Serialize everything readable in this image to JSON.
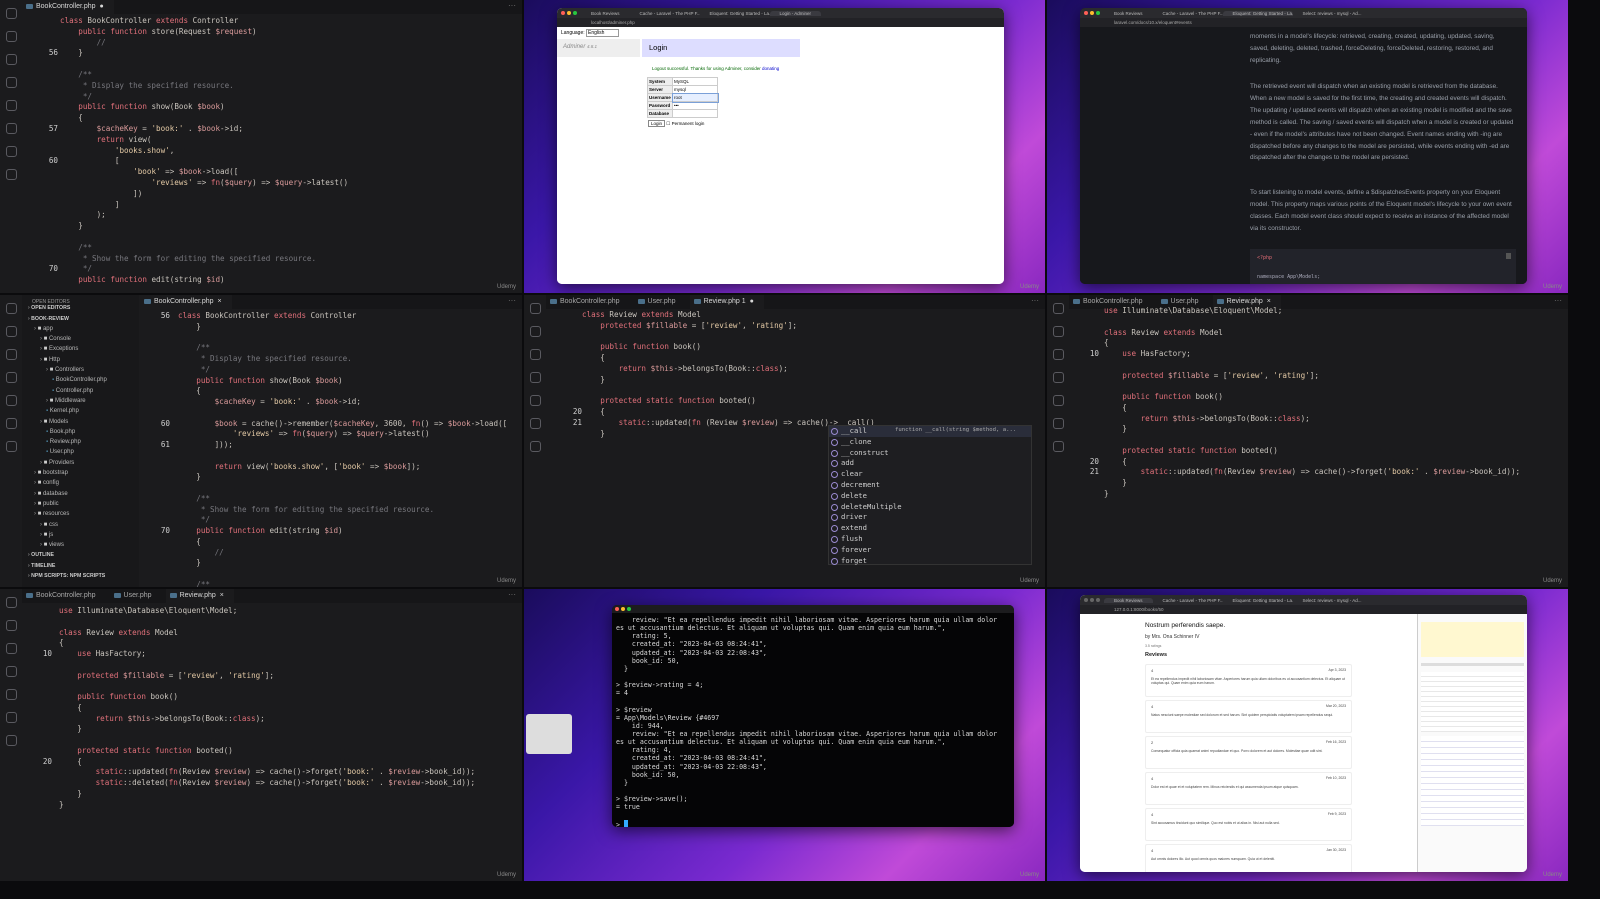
{
  "watermark": "Udemy",
  "p1": {
    "tabs": [
      {
        "label": "BookController.php",
        "state": "●"
      }
    ],
    "lines": [
      [
        "",
        "class BookController extends Controller"
      ],
      [
        "",
        "    public function store(Request $request)"
      ],
      [
        "",
        "        //"
      ],
      [
        "56",
        "    }"
      ],
      [
        "",
        ""
      ],
      [
        "",
        "    /**"
      ],
      [
        "",
        "     * Display the specified resource."
      ],
      [
        "",
        "     */"
      ],
      [
        "",
        "    public function show(Book $book)"
      ],
      [
        "",
        "    {"
      ],
      [
        "57",
        "        $cacheKey = 'book:' . $book->id;"
      ],
      [
        "",
        "        return view("
      ],
      [
        "",
        "            'books.show',"
      ],
      [
        "60",
        "            ["
      ],
      [
        "",
        "                'book' => $book->load(["
      ],
      [
        "",
        "                    'reviews' => fn($query) => $query->latest()"
      ],
      [
        "",
        "                ])"
      ],
      [
        "",
        "            ]"
      ],
      [
        "",
        "        );"
      ],
      [
        "",
        "    }"
      ],
      [
        "",
        ""
      ],
      [
        "",
        "    /**"
      ],
      [
        "",
        "     * Show the form for editing the specified resource."
      ],
      [
        "70",
        "     */"
      ],
      [
        "",
        "    public function edit(string $id)"
      ]
    ]
  },
  "p2": {
    "tabs": [
      "Book Reviews",
      "Cache - Laravel - The PHP F...",
      "Eloquent: Getting Started - La...",
      "Login - Adminer"
    ],
    "url": "localhost/adminer.php",
    "language_label": "Language:",
    "language_value": "English",
    "app_name": "Adminer",
    "app_version": "4.8.1",
    "title": "Login",
    "message": "Logout successful. Thanks for using Adminer, consider",
    "message_link": "donating",
    "fields": [
      {
        "label": "System",
        "value": "MySQL"
      },
      {
        "label": "Server",
        "value": "mysql"
      },
      {
        "label": "Username",
        "value": "root"
      },
      {
        "label": "Password",
        "value": "•••"
      },
      {
        "label": "Database",
        "value": ""
      }
    ],
    "login_button": "Login",
    "permanent_label": "Permanent login"
  },
  "p3": {
    "tabs": [
      "Book Reviews",
      "Cache - Laravel - The PHP F...",
      "Eloquent: Getting Started - La...",
      "Select: reviews - mysql - Ad..."
    ],
    "url": "laravel.com/docs/10.x/eloquent#events",
    "paragraphs": [
      "moments in a model's lifecycle: retrieved, creating, created, updating, updated, saving, saved, deleting, deleted, trashed, forceDeleting, forceDeleted, restoring, restored, and replicating.",
      "The retrieved event will dispatch when an existing model is retrieved from the database. When a new model is saved for the first time, the creating and created events will dispatch. The updating / updated events will dispatch when an existing model is modified and the save method is called. The saving / saved events will dispatch when a model is created or updated - even if the model's attributes have not been changed. Event names ending with -ing are dispatched before any changes to the model are persisted, while events ending with -ed are dispatched after the changes to the model are persisted.",
      "To start listening to model events, define a $dispatchesEvents property on your Eloquent model. This property maps various points of the Eloquent model's lifecycle to your own event classes. Each model event class should expect to receive an instance of the affected model via its constructor."
    ],
    "code": [
      "<?php",
      "namespace App\\Models;"
    ]
  },
  "p4": {
    "explorer_title": "OPEN EDITORS",
    "tabs": [
      {
        "label": "BookController.php",
        "state": "×"
      }
    ],
    "tree": [
      {
        "d": 0,
        "t": "OPEN EDITORS",
        "h": 1
      },
      {
        "d": 0,
        "t": "BOOK-REVIEW",
        "h": 1
      },
      {
        "d": 1,
        "t": "app",
        "f": 1
      },
      {
        "d": 2,
        "t": "Console",
        "f": 1
      },
      {
        "d": 2,
        "t": "Exceptions",
        "f": 1
      },
      {
        "d": 2,
        "t": "Http",
        "f": 1
      },
      {
        "d": 3,
        "t": "Controllers",
        "f": 1
      },
      {
        "d": 4,
        "t": "BookController.php"
      },
      {
        "d": 4,
        "t": "Controller.php"
      },
      {
        "d": 3,
        "t": "Middleware",
        "f": 1
      },
      {
        "d": 3,
        "t": "Kernel.php"
      },
      {
        "d": 2,
        "t": "Models",
        "f": 1
      },
      {
        "d": 3,
        "t": "Book.php"
      },
      {
        "d": 3,
        "t": "Review.php"
      },
      {
        "d": 3,
        "t": "User.php"
      },
      {
        "d": 2,
        "t": "Providers",
        "f": 1
      },
      {
        "d": 1,
        "t": "bootstrap",
        "f": 1
      },
      {
        "d": 1,
        "t": "config",
        "f": 1
      },
      {
        "d": 1,
        "t": "database",
        "f": 1
      },
      {
        "d": 1,
        "t": "public",
        "f": 1
      },
      {
        "d": 1,
        "t": "resources",
        "f": 1
      },
      {
        "d": 2,
        "t": "css",
        "f": 1
      },
      {
        "d": 2,
        "t": "js",
        "f": 1
      },
      {
        "d": 2,
        "t": "views",
        "f": 1
      },
      {
        "d": 0,
        "t": "OUTLINE",
        "h": 1
      },
      {
        "d": 0,
        "t": "TIMELINE",
        "h": 1
      },
      {
        "d": 0,
        "t": "NPM SCRIPTS: NPM SCRIPTS",
        "h": 1
      }
    ],
    "lines": [
      [
        "56",
        "class BookController extends Controller"
      ],
      [
        "",
        "    }"
      ],
      [
        "",
        ""
      ],
      [
        "",
        "    /**"
      ],
      [
        "",
        "     * Display the specified resource."
      ],
      [
        "",
        "     */"
      ],
      [
        "",
        "    public function show(Book $book)"
      ],
      [
        "",
        "    {"
      ],
      [
        "",
        "        $cacheKey = 'book:' . $book->id;"
      ],
      [
        "",
        ""
      ],
      [
        "60",
        "        $book = cache()->remember($cacheKey, 3600, fn() => $book->load(["
      ],
      [
        "",
        "            'reviews' => fn($query) => $query->latest()"
      ],
      [
        "61",
        "        ]));"
      ],
      [
        "",
        ""
      ],
      [
        "",
        "        return view('books.show', ['book' => $book]);"
      ],
      [
        "",
        "    }"
      ],
      [
        "",
        ""
      ],
      [
        "",
        "    /**"
      ],
      [
        "",
        "     * Show the form for editing the specified resource."
      ],
      [
        "",
        "     */"
      ],
      [
        "70",
        "    public function edit(string $id)"
      ],
      [
        "",
        "    {"
      ],
      [
        "",
        "        //"
      ],
      [
        "",
        "    }"
      ],
      [
        "",
        ""
      ],
      [
        "",
        "    /**"
      ]
    ]
  },
  "p5": {
    "tabs": [
      {
        "label": "BookController.php",
        "state": ""
      },
      {
        "label": "User.php",
        "state": ""
      },
      {
        "label": "Review.php 1",
        "state": "●"
      }
    ],
    "lines": [
      [
        "",
        "class Review extends Model"
      ],
      [
        "",
        "    protected $fillable = ['review', 'rating'];"
      ],
      [
        "",
        ""
      ],
      [
        "",
        "    public function book()"
      ],
      [
        "",
        "    {"
      ],
      [
        "",
        "        return $this->belongsTo(Book::class);"
      ],
      [
        "",
        "    }"
      ],
      [
        "",
        ""
      ],
      [
        "",
        "    protected static function booted()"
      ],
      [
        "20",
        "    {"
      ],
      [
        "21",
        "        static::updated(fn (Review $review) => cache()->__call()"
      ],
      [
        "",
        "    }"
      ]
    ],
    "autocomplete": [
      "__call",
      "__clone",
      "__construct",
      "add",
      "clear",
      "decrement",
      "delete",
      "deleteMultiple",
      "driver",
      "extend",
      "flush",
      "forever",
      "forget"
    ],
    "autocomplete_detail": "function __call(string $method, a..."
  },
  "p6": {
    "tabs": [
      {
        "label": "BookController.php",
        "state": ""
      },
      {
        "label": "User.php",
        "state": ""
      },
      {
        "label": "Review.php",
        "state": "×"
      }
    ],
    "lines": [
      [
        "",
        "use Illuminate\\Database\\Eloquent\\Model;"
      ],
      [
        "",
        ""
      ],
      [
        "",
        "class Review extends Model"
      ],
      [
        "",
        "{"
      ],
      [
        "10",
        "    use HasFactory;"
      ],
      [
        "",
        ""
      ],
      [
        "",
        "    protected $fillable = ['review', 'rating'];"
      ],
      [
        "",
        ""
      ],
      [
        "",
        "    public function book()"
      ],
      [
        "",
        "    {"
      ],
      [
        "",
        "        return $this->belongsTo(Book::class);"
      ],
      [
        "",
        "    }"
      ],
      [
        "",
        ""
      ],
      [
        "",
        "    protected static function booted()"
      ],
      [
        "20",
        "    {"
      ],
      [
        "21",
        "        static::updated(fn(Review $review) => cache()->forget('book:' . $review->book_id));"
      ],
      [
        "",
        "    }"
      ],
      [
        "",
        "}"
      ]
    ]
  },
  "p7": {
    "tabs": [
      {
        "label": "BookController.php",
        "state": ""
      },
      {
        "label": "User.php",
        "state": ""
      },
      {
        "label": "Review.php",
        "state": "×"
      }
    ],
    "lines": [
      [
        "",
        "use Illuminate\\Database\\Eloquent\\Model;"
      ],
      [
        "",
        ""
      ],
      [
        "",
        "class Review extends Model"
      ],
      [
        "",
        "{"
      ],
      [
        "10",
        "    use HasFactory;"
      ],
      [
        "",
        ""
      ],
      [
        "",
        "    protected $fillable = ['review', 'rating'];"
      ],
      [
        "",
        ""
      ],
      [
        "",
        "    public function book()"
      ],
      [
        "",
        "    {"
      ],
      [
        "",
        "        return $this->belongsTo(Book::class);"
      ],
      [
        "",
        "    }"
      ],
      [
        "",
        ""
      ],
      [
        "",
        "    protected static function booted()"
      ],
      [
        "20",
        "    {"
      ],
      [
        "",
        "        static::updated(fn(Review $review) => cache()->forget('book:' . $review->book_id));"
      ],
      [
        "",
        "        static::deleted(fn(Review $review) => cache()->forget('book:' . $review->book_id));"
      ],
      [
        "",
        "    }"
      ],
      [
        "",
        "}"
      ]
    ]
  },
  "p8": {
    "lines": [
      "    review: \"Et ea repellendus impedit nihil laboriosam vitae. Asperiores harum quia ullam dolor",
      "es ut accusantium delectus. Et aliquam ut voluptas qui. Quam enim quia eum harum.\",",
      "    rating: 5,",
      "    created_at: \"2023-04-03 08:24:41\",",
      "    updated_at: \"2023-04-03 22:08:43\",",
      "    book_id: 50,",
      "  }",
      "",
      "> $review->rating = 4;",
      "= 4",
      "",
      "> $review",
      "= App\\Models\\Review {#4697",
      "    id: 944,",
      "    review: \"Et ea repellendus impedit nihil laboriosam vitae. Asperiores harum quia ullam dolor",
      "es ut accusantium delectus. Et aliquam ut voluptas qui. Quam enim quia eum harum.\",",
      "    rating: 4,",
      "    created_at: \"2023-04-03 08:24:41\",",
      "    updated_at: \"2023-04-03 22:08:43\",",
      "    book_id: 50,",
      "  }",
      "",
      "> $review->save();",
      "= true",
      "",
      "> "
    ]
  },
  "p9": {
    "tabs": [
      "Book Reviews",
      "Cache - Laravel - The PHP F...",
      "Eloquent: Getting Started - La...",
      "Select: reviews - mysql - Ad..."
    ],
    "url": "127.0.0.1:8000/books/50",
    "book_title": "Nostrum perferendis saepe.",
    "author": "by Mrs. Ona Schinner IV",
    "rating": "3.5 ratings",
    "reviews_heading": "Reviews",
    "reviews": [
      {
        "rating": "4",
        "date": "Apr 3, 2023",
        "text": "Et ea repellendus impedit nihil laboriosam vitae. Asperiores harum quia ullam doloribus es ut accusantium delectus. Et aliquam ut voluptas qui. Quam enim quia eum harum."
      },
      {
        "rating": "4",
        "date": "Mar 20, 2023",
        "text": "Natus nesciunt saepe molestiae sed dolorum et sed harum. Sint quidem perspiciatis voluptatem ipsam repellendus sequi."
      },
      {
        "rating": "2",
        "date": "Feb 16, 2023",
        "text": "Consequatur officia quia quaerat animi repudiandae et quo. Porro dolorem et aut dolores. Molestiae quae odit sint."
      },
      {
        "rating": "4",
        "date": "Feb 10, 2023",
        "text": "Dolor est et quae et et voluptatem rem. Minus reiciendis et qui assumenda ipsum atque quisquam."
      },
      {
        "rating": "4",
        "date": "Feb 9, 2023",
        "text": "Sint accusamus tincidunt quo similique. Quo est nobis et ut alias in. Nisi aut nulla sed."
      },
      {
        "rating": "4",
        "date": "Jan 30, 2023",
        "text": "Aut omnis dolores illo. Aut quod omnis quos maiores numquam. Quia ut et deleniti."
      }
    ]
  }
}
